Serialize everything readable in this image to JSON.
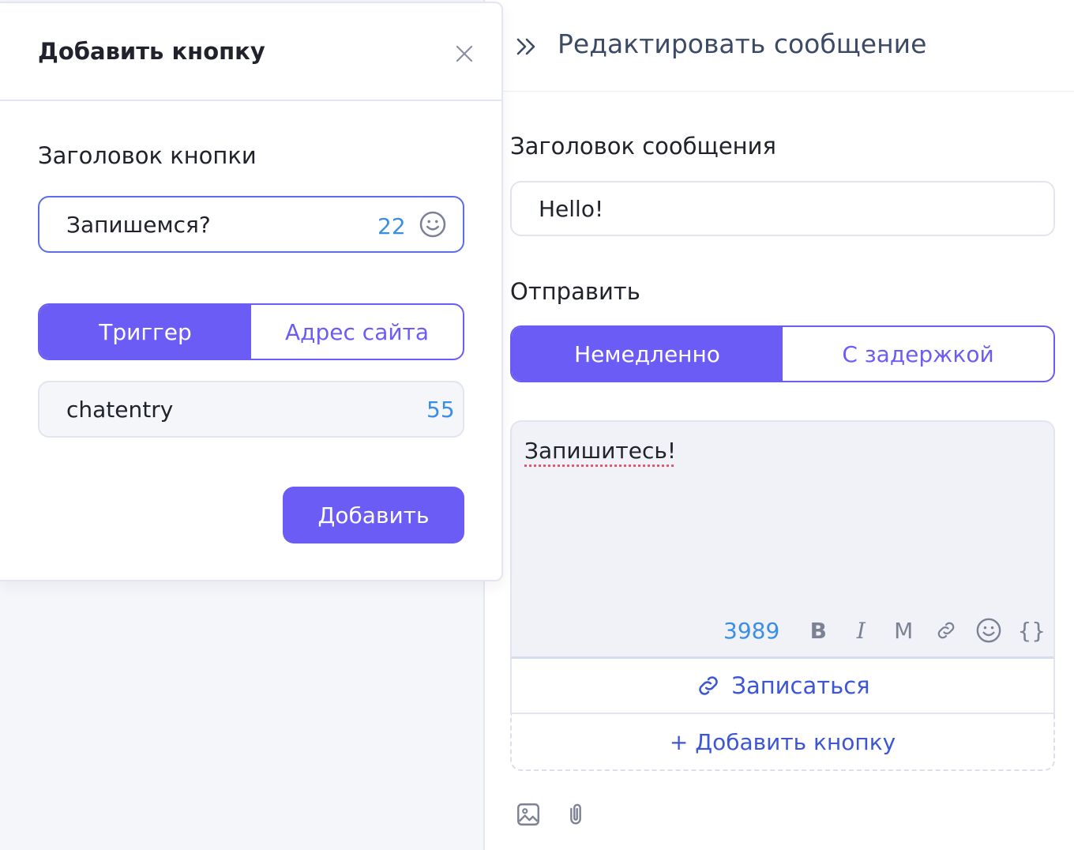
{
  "editor_panel": {
    "title": "Редактировать сообщение",
    "message_title_label": "Заголовок сообщения",
    "message_title_value": "Hello!",
    "send_label": "Отправить",
    "send_options": [
      "Немедленно",
      "С задержкой"
    ],
    "send_selected": "Немедленно",
    "message_text": "Запишитесь!",
    "char_counter": "3989",
    "toolbar": {
      "bold": "B",
      "italic": "I",
      "mono": "M",
      "variables": "{}"
    },
    "buttons": [
      {
        "label": "Записаться",
        "icon": "link-icon"
      }
    ],
    "add_button_label": "+ Добавить кнопку"
  },
  "modal": {
    "title": "Добавить кнопку",
    "button_title_label": "Заголовок кнопки",
    "button_title_value": "Запишемся?",
    "button_title_counter": "22",
    "type_options": [
      "Триггер",
      "Адрес сайта"
    ],
    "type_selected": "Триггер",
    "trigger_value": "chatentry",
    "trigger_counter": "55",
    "submit_label": "Добавить"
  },
  "colors": {
    "accent": "#6c5cf6",
    "link": "#3d56d6",
    "counter": "#3a8ee6"
  }
}
